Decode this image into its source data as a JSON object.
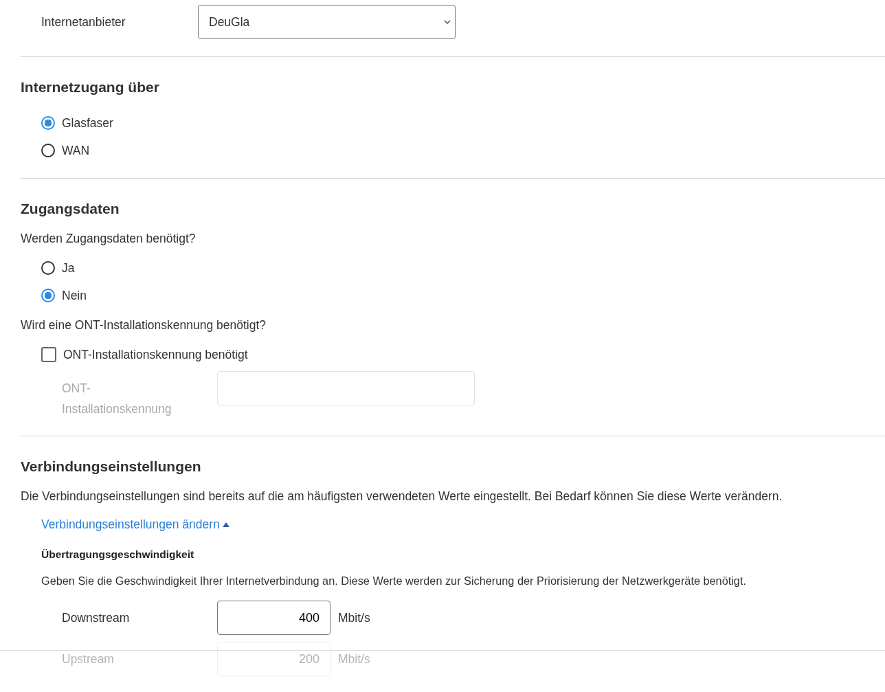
{
  "provider": {
    "label": "Internetanbieter",
    "value": "DeuGla"
  },
  "access": {
    "heading": "Internetzugang über",
    "options": [
      {
        "label": "Glasfaser",
        "selected": true
      },
      {
        "label": "WAN",
        "selected": false
      }
    ]
  },
  "credentials": {
    "heading": "Zugangsdaten",
    "question": "Werden Zugangsdaten benötigt?",
    "options": [
      {
        "label": "Ja",
        "selected": false
      },
      {
        "label": "Nein",
        "selected": true
      }
    ],
    "ont_question": "Wird eine ONT-Installationskennung benötigt?",
    "ont_checkbox": {
      "label": "ONT-Installationskennung benötigt",
      "checked": false
    },
    "ont_field": {
      "label_lines": [
        "ONT-",
        "Installationskennung"
      ],
      "disabled": true
    }
  },
  "connection": {
    "heading": "Verbindungseinstellungen",
    "text": "Die Verbindungseinstellungen sind bereits auf die am häufigsten verwendeten Werte eingestellt. Bei Bedarf können Sie diese Werte verändern.",
    "toggle": {
      "label": "Verbindungseinstellungen ändern",
      "expanded": true
    },
    "speed": {
      "heading": "Übertragungsgeschwindigkeit",
      "text": "Geben Sie die Geschwindigkeit Ihrer Internetverbindung an. Diese Werte werden zur Sicherung der Priorisierung der Netzwerkgeräte benötigt.",
      "rows": [
        {
          "label": "Downstream",
          "value": "400",
          "unit": "Mbit/s",
          "faded": false
        },
        {
          "label": "Upstream",
          "value": "200",
          "unit": "Mbit/s",
          "faded": true
        }
      ]
    }
  }
}
